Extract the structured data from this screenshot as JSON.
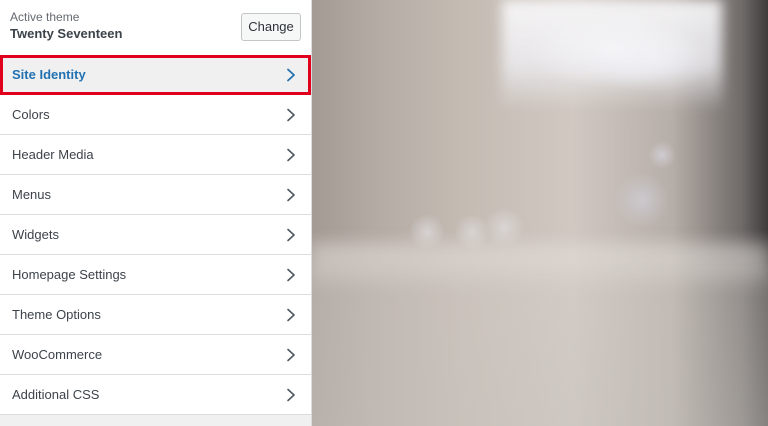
{
  "theme": {
    "label": "Active theme",
    "name": "Twenty Seventeen",
    "change_label": "Change"
  },
  "menu": {
    "items": [
      {
        "label": "Site Identity",
        "selected": true
      },
      {
        "label": "Colors"
      },
      {
        "label": "Header Media"
      },
      {
        "label": "Menus"
      },
      {
        "label": "Widgets"
      },
      {
        "label": "Homepage Settings"
      },
      {
        "label": "Theme Options"
      },
      {
        "label": "WooCommerce"
      },
      {
        "label": "Additional CSS"
      }
    ]
  },
  "colors": {
    "selected_text": "#2271b1",
    "highlight_border": "#e0001b",
    "item_text": "#3c434a",
    "chevron": "#50575e"
  },
  "icons": {
    "chevron": "chevron-right-icon"
  }
}
